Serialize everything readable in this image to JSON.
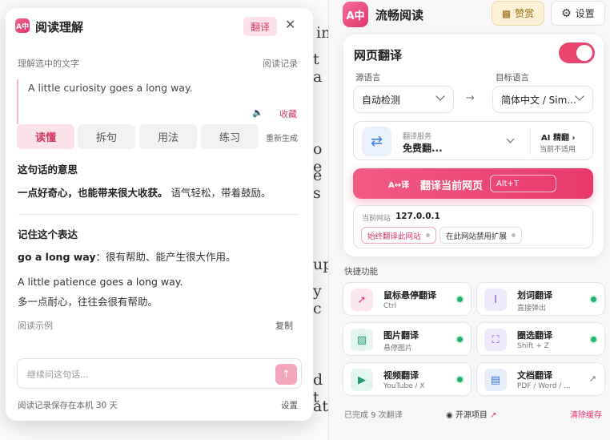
{
  "background": {
    "fragments": [
      "in",
      "t a",
      "o e",
      "e s",
      "up",
      "y c",
      "d t",
      "at"
    ]
  },
  "reader": {
    "title": "阅读理解",
    "logo_text": "A中",
    "translate_btn": "翻译",
    "close_glyph": "✕",
    "selection_label": "理解选中的文字",
    "history_link": "阅读记录",
    "selected_text": "A little curiosity goes a long way.",
    "speak_glyph": "🔈",
    "collect_label": "收藏",
    "tabs": [
      "读懂",
      "拆句",
      "用法",
      "练习"
    ],
    "active_tab": "读懂",
    "regenerate": "重新生成",
    "meaning_title": "这句话的意思",
    "meaning_bold": "一点好奇心，也能带来很大收获。",
    "meaning_rest": "语气轻松，带着鼓励。",
    "remember_title": "记住这个表达",
    "phrase_bold": "go a long way",
    "phrase_rest": "：很有帮助、能产生很大作用。",
    "example_en": "A little patience goes a long way.",
    "example_zh": "多一点耐心，往往会很有帮助。",
    "example_label": "阅读示例",
    "copy_label": "复制",
    "ask_placeholder": "继续问这句话...",
    "send_glyph": "↑",
    "footer_note": "阅读记录保存在本机 30 天",
    "settings_link": "设置"
  },
  "panel": {
    "logo_text": "A中",
    "app_title": "流畅阅读",
    "like_label": "赞赏",
    "settings_label": "设置",
    "webpage_translate": {
      "title": "网页翻译",
      "enabled": true,
      "source_label": "源语言",
      "source_value": "自动检测",
      "target_label": "目标语言",
      "target_value": "简体中文 / Sim...",
      "arrow": "→",
      "service_label": "翻译服务",
      "service_value": "免费翻...",
      "ai_title": "AI 精翻 ›",
      "ai_sub": "当前不适用",
      "translate_icon": "A↔译",
      "translate_label": "翻译当前网页",
      "translate_shortcut": "Alt+T",
      "site_label": "当前网站",
      "site_host": "127.0.0.1",
      "always_translate": "始终翻译此网站",
      "disable_on_site": "在此网站禁用扩展"
    },
    "quick_label": "快捷功能",
    "features": [
      {
        "title": "鼠标悬停翻译",
        "sub": "Ctrl",
        "icon": "cursor-icon",
        "glyph": "➚",
        "status": "on"
      },
      {
        "title": "划词翻译",
        "sub": "直接弹出",
        "icon": "text-cursor-icon",
        "glyph": "I",
        "status": "on"
      },
      {
        "title": "图片翻译",
        "sub": "悬停图片",
        "icon": "image-icon",
        "glyph": "▧",
        "status": "on"
      },
      {
        "title": "圈选翻译",
        "sub": "Shift + Z",
        "icon": "select-region-icon",
        "glyph": "⛶",
        "status": "on"
      },
      {
        "title": "视频翻译",
        "sub": "YouTube / X",
        "icon": "video-icon",
        "glyph": "▶",
        "status": "on"
      },
      {
        "title": "文档翻译",
        "sub": "PDF / Word / ...",
        "icon": "document-icon",
        "glyph": "▤",
        "status": "link"
      }
    ],
    "footer": {
      "count": "已完成 9 次翻译",
      "open_source": "开源项目",
      "clear_cache": "清除缓存"
    }
  },
  "colors": {
    "accent": "#e8386b",
    "accent_light": "#fbe1e8",
    "success": "#20b26c"
  }
}
